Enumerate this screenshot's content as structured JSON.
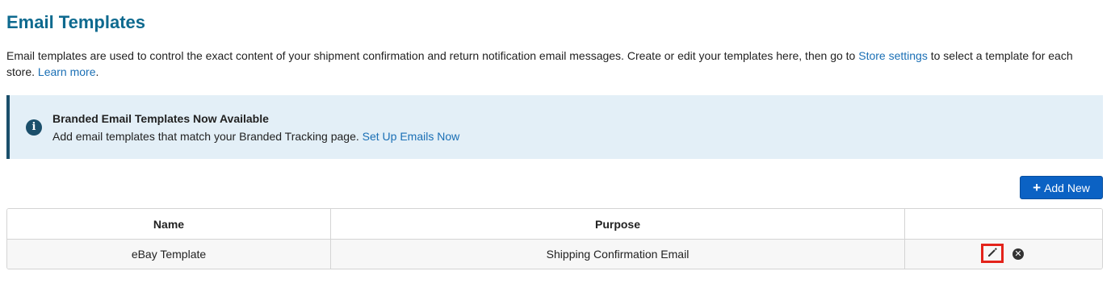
{
  "page": {
    "title": "Email Templates",
    "description_part1": "Email templates are used to control the exact content of your shipment confirmation and return notification email messages. Create or edit your templates here, then go to ",
    "store_settings_link": "Store settings",
    "description_part2": " to select a template for each store. ",
    "learn_more_link": "Learn more",
    "description_end": "."
  },
  "banner": {
    "icon": "info-icon",
    "title": "Branded Email Templates Now Available",
    "text": "Add email templates that match your Branded Tracking page. ",
    "link": "Set Up Emails Now"
  },
  "toolbar": {
    "add_icon": "plus-icon",
    "add_label": "Add New"
  },
  "table": {
    "headers": [
      "Name",
      "Purpose",
      ""
    ],
    "rows": [
      {
        "name": "eBay Template",
        "purpose": "Shipping Confirmation Email",
        "edit_icon": "pencil-icon",
        "delete_icon": "close-circle-icon"
      }
    ]
  },
  "colors": {
    "title": "#0e6a8f",
    "link": "#1a6fb5",
    "banner_background": "#e3eff7",
    "banner_accent": "#1b4f6b",
    "primary_button": "#0b62c4",
    "highlight_border": "#e3231b"
  }
}
